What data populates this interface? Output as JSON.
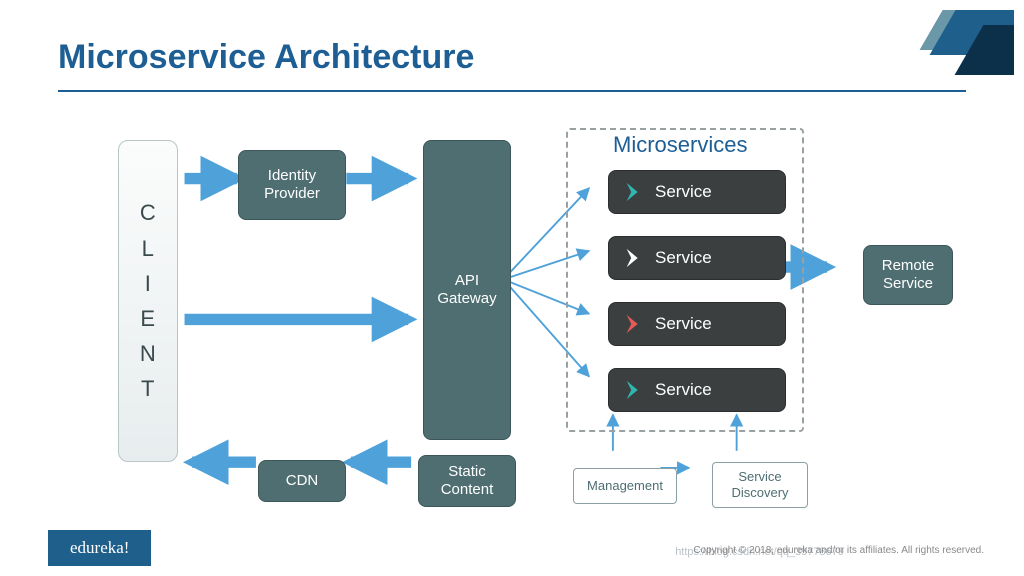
{
  "title": "Microservice Architecture",
  "client_label": "C\nL\nI\nE\nN\nT",
  "boxes": {
    "identity": "Identity\nProvider",
    "api": "API\nGateway",
    "static": "Static\nContent",
    "cdn": "CDN",
    "remote": "Remote\nService",
    "management": "Management",
    "discovery": "Service\nDiscovery"
  },
  "microservices": {
    "heading": "Microservices",
    "items": [
      {
        "label": "Service",
        "accent": "#2fb7ae"
      },
      {
        "label": "Service",
        "accent": "#ffffff"
      },
      {
        "label": "Service",
        "accent": "#e45a5a"
      },
      {
        "label": "Service",
        "accent": "#2fb7ae"
      }
    ]
  },
  "brand": "edureka!",
  "copyright": "Copyright © 2018, edureka and/or its affiliates. All rights reserved.",
  "watermark": "https://blog.csdn.net/qq_39778679"
}
